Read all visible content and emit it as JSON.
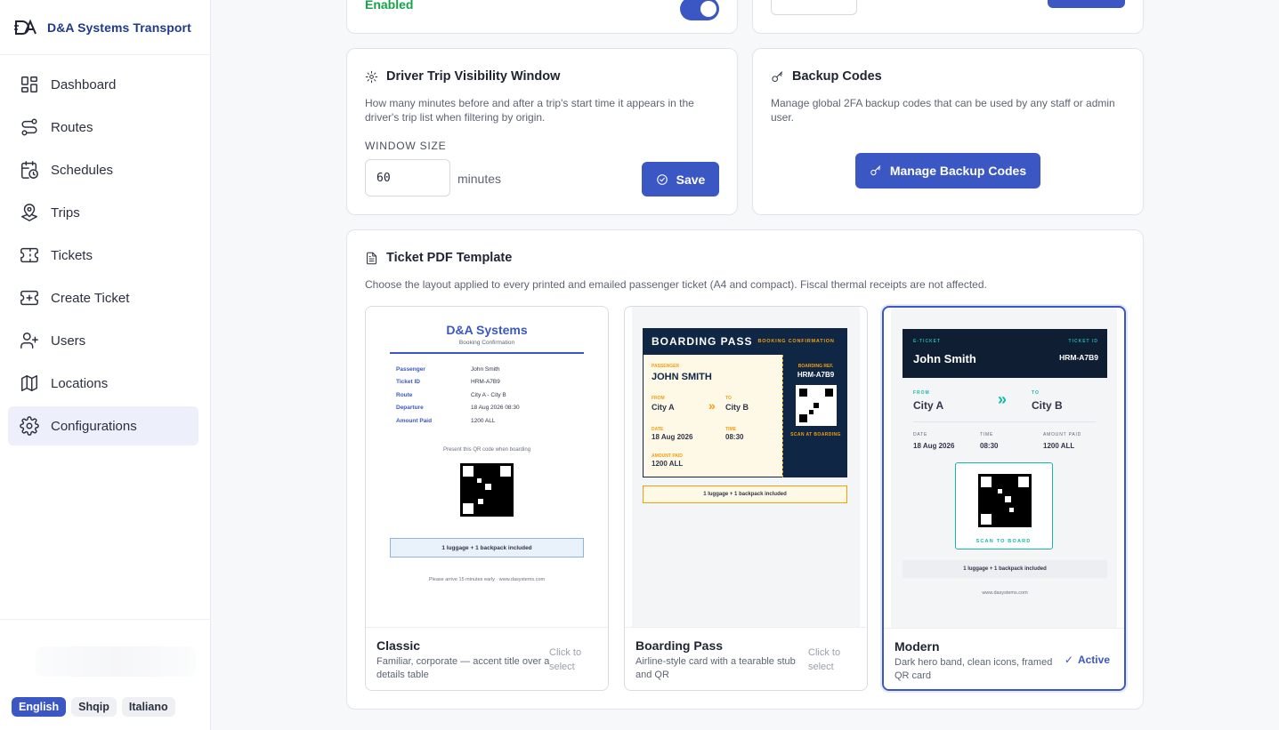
{
  "brand": {
    "name": "D&A Systems Transport"
  },
  "nav": [
    {
      "label": "Dashboard",
      "icon": "dashboard-icon"
    },
    {
      "label": "Routes",
      "icon": "route-icon"
    },
    {
      "label": "Schedules",
      "icon": "calendar-clock-icon"
    },
    {
      "label": "Trips",
      "icon": "map-pin-icon"
    },
    {
      "label": "Tickets",
      "icon": "ticket-icon"
    },
    {
      "label": "Create Ticket",
      "icon": "ticket-plus-icon"
    },
    {
      "label": "Users",
      "icon": "user-plus-icon"
    },
    {
      "label": "Locations",
      "icon": "map-icon"
    },
    {
      "label": "Configurations",
      "icon": "gear-icon"
    }
  ],
  "languages": [
    "English",
    "Shqip",
    "Italiano"
  ],
  "top_left": {
    "status": "Enabled"
  },
  "visibility": {
    "title": "Driver Trip Visibility Window",
    "description": "How many minutes before and after a trip's start time it appears in the driver's trip list when filtering by origin.",
    "field_label": "WINDOW SIZE",
    "value": "60",
    "unit": "minutes",
    "save": "Save"
  },
  "backup": {
    "title": "Backup Codes",
    "description": "Manage global 2FA backup codes that can be used by any staff or admin user.",
    "button": "Manage Backup Codes"
  },
  "template": {
    "title": "Ticket PDF Template",
    "description": "Choose the layout applied to every printed and emailed passenger ticket (A4 and compact). Fiscal thermal receipts are not affected.",
    "options": [
      {
        "name": "Classic",
        "desc": "Familiar, corporate — accent title over a details table",
        "hint": "Click to select"
      },
      {
        "name": "Boarding Pass",
        "desc": "Airline-style card with a tearable stub and QR",
        "hint": "Click to select"
      },
      {
        "name": "Modern",
        "desc": "Dark hero band, clean icons, framed QR card",
        "status": "Active"
      }
    ]
  },
  "classic_preview": {
    "title": "D&A Systems",
    "subtitle": "Booking Confirmation",
    "rows": [
      {
        "k": "Passenger",
        "v": "John Smith"
      },
      {
        "k": "Ticket ID",
        "v": "HRM-A7B9"
      },
      {
        "k": "Route",
        "v": "City A - City B"
      },
      {
        "k": "Departure",
        "v": "18 Aug 2026 08:30"
      },
      {
        "k": "Amount Paid",
        "v": "1200 ALL"
      }
    ],
    "qr_note": "Present this QR code when boarding",
    "luggage": "1 luggage + 1 backpack included",
    "footer": "Please arrive 15 minutes early · www.dasystems.com"
  },
  "boarding_preview": {
    "title": "BOARDING PASS",
    "tag": "BOOKING CONFIRMATION",
    "passenger_label": "PASSENGER",
    "passenger": "JOHN SMITH",
    "from_label": "FROM",
    "from": "City A",
    "to_label": "TO",
    "to": "City B",
    "date_label": "DATE",
    "date": "18 Aug 2026",
    "time_label": "TIME",
    "time": "08:30",
    "amount_label": "AMOUNT PAID",
    "amount": "1200 ALL",
    "ref_label": "BOARDING REF.",
    "ref": "HRM-A7B9",
    "scan": "SCAN AT BOARDING",
    "luggage": "1 luggage + 1 backpack included"
  },
  "modern_preview": {
    "eticket": "E-TICKET",
    "ticket_id_label": "TICKET ID",
    "name": "John Smith",
    "ticket_id": "HRM-A7B9",
    "from_label": "FROM",
    "from": "City A",
    "to_label": "TO",
    "to": "City B",
    "date_label": "DATE",
    "date": "18 Aug 2026",
    "time_label": "TIME",
    "time": "08:30",
    "amount_label": "AMOUNT PAID",
    "amount": "1200 ALL",
    "scan": "SCAN TO BOARD",
    "luggage": "1 luggage + 1 backpack included",
    "footer": "www.dasystems.com"
  },
  "colors": {
    "accent": "#3b57c4",
    "success": "#16a34a",
    "navy": "#0f2744",
    "orange": "#f59e0b",
    "teal": "#14b8a6"
  }
}
